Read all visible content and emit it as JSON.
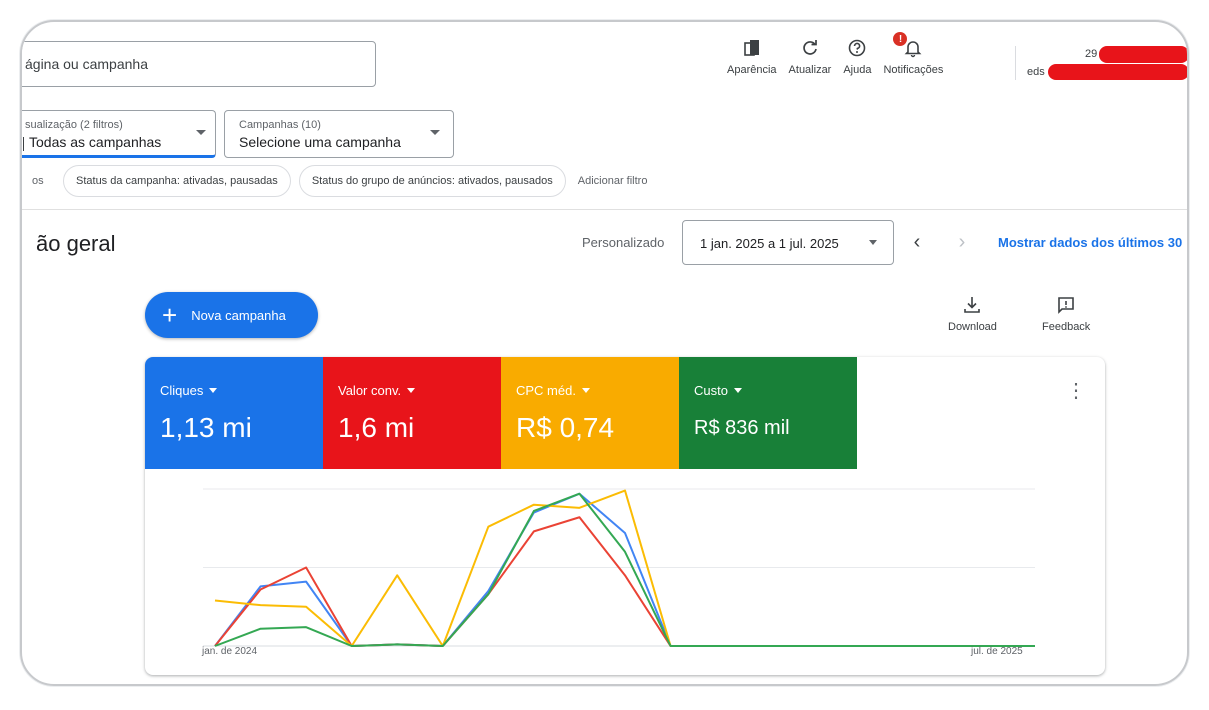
{
  "search": {
    "placeholder": "ágina ou campanha"
  },
  "top_actions": [
    {
      "icon": "appearance-icon",
      "label": "Aparência"
    },
    {
      "icon": "refresh-icon",
      "label": "Atualizar"
    },
    {
      "icon": "help-icon",
      "label": "Ajuda"
    },
    {
      "icon": "bell-icon",
      "label": "Notificações"
    }
  ],
  "notification_badge": "!",
  "account": {
    "id_prefix": "29",
    "email_prefix": "eds"
  },
  "filters": {
    "view_small": "sualização (2 filtros)",
    "view_main": "Todas as campanhas",
    "campaigns_small": "Campanhas (10)",
    "campaigns_main": "Selecione uma campanha",
    "cut_chip": "os",
    "chips": [
      "Status da campanha: ativadas, pausadas",
      "Status do grupo de anúncios: ativados, pausados"
    ],
    "add_filter": "Adicionar filtro"
  },
  "page": {
    "title": "ão geral",
    "date_label": "Personalizado",
    "date_range": "1 jan. 2025 a 1 jul. 2025",
    "show_last": "Mostrar dados dos últimos 30"
  },
  "toolbar": {
    "new_campaign": "Nova campanha",
    "download": "Download",
    "feedback": "Feedback"
  },
  "metrics": [
    {
      "name": "Cliques",
      "value": "1,13 mi",
      "color": "#1a73e8"
    },
    {
      "name": "Valor conv.",
      "value": "1,6 mi",
      "color": "#e8141a"
    },
    {
      "name": "CPC méd.",
      "value": "R$ 0,74",
      "color": "#f9ab00"
    },
    {
      "name": "Custo",
      "value": "R$ 836 mil",
      "color": "#188038"
    }
  ],
  "chart_data": {
    "type": "line",
    "x_start_label": "jan. de 2024",
    "x_end_label": "jul. de 2025",
    "x": [
      "jan. de 2024",
      "",
      "",
      "",
      "",
      "",
      "",
      "",
      "",
      "",
      "",
      "",
      "",
      "",
      "",
      "",
      "",
      "",
      "jul. de 2025"
    ],
    "ylim": [
      0,
      100
    ],
    "series": [
      {
        "name": "Cliques",
        "color": "#4285f4",
        "values": [
          0,
          38,
          41,
          0,
          1,
          0,
          35,
          85,
          97,
          72,
          0,
          0,
          0,
          0,
          0,
          0,
          0,
          0,
          0
        ]
      },
      {
        "name": "Valor conv.",
        "color": "#ea4335",
        "values": [
          0,
          36,
          50,
          0,
          1,
          0,
          33,
          73,
          82,
          45,
          0,
          0,
          0,
          0,
          0,
          0,
          0,
          0,
          0
        ]
      },
      {
        "name": "CPC méd.",
        "color": "#fbbc04",
        "values": [
          29,
          26,
          25,
          0,
          45,
          0,
          76,
          90,
          88,
          99,
          0,
          0,
          0,
          0,
          0,
          0,
          0,
          0,
          0
        ]
      },
      {
        "name": "Custo",
        "color": "#34a853",
        "values": [
          0,
          11,
          12,
          0,
          1,
          0,
          33,
          86,
          97,
          60,
          0,
          0,
          0,
          0,
          0,
          0,
          0,
          0,
          0
        ]
      }
    ]
  }
}
